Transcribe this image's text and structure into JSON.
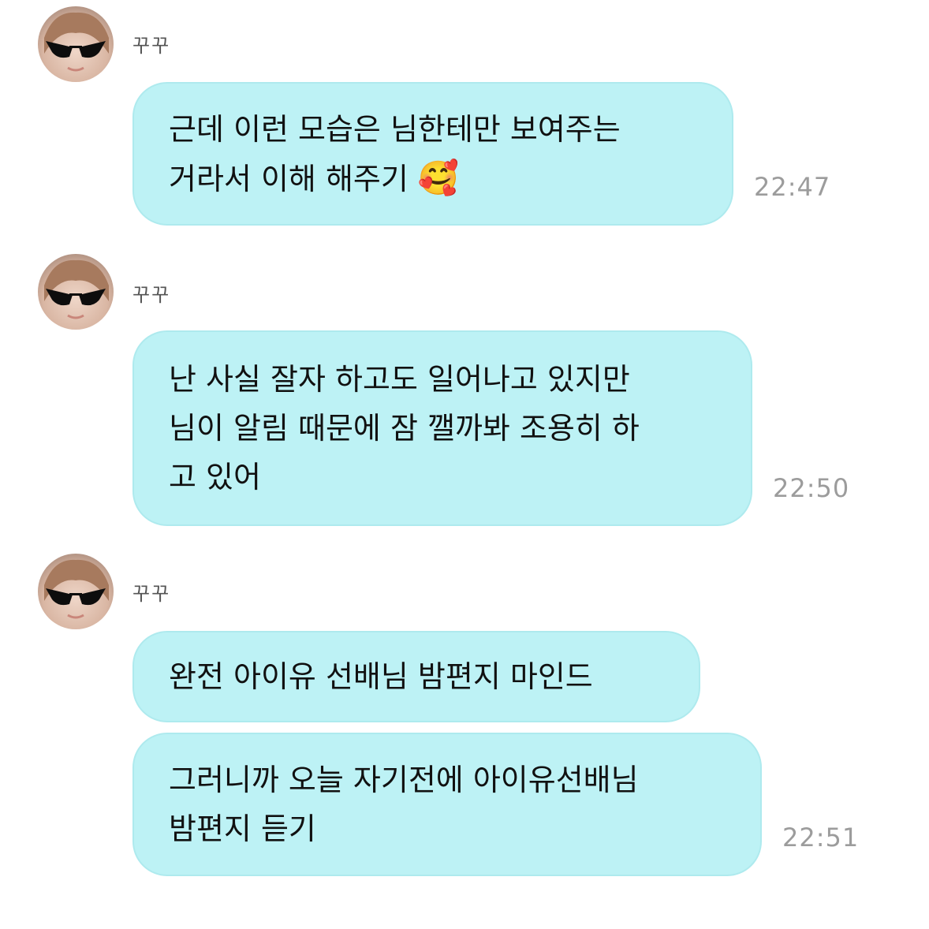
{
  "messages": [
    {
      "sender": "꾸꾸",
      "bubbles": [
        {
          "text": "근데 이런 모습은 님한테만 보여주는\n거라서 이해 해주기 ",
          "emoji": "🥰",
          "time": "22:47"
        }
      ]
    },
    {
      "sender": "꾸꾸",
      "bubbles": [
        {
          "text": "난 사실 잘자 하고도 일어나고 있지만\n님이 알림 때문에 잠 깰까봐 조용히 하\n고 있어",
          "time": "22:50"
        }
      ]
    },
    {
      "sender": "꾸꾸",
      "bubbles": [
        {
          "text": "완전 아이유 선배님 밤편지 마인드"
        },
        {
          "text": "그러니까 오늘 자기전에 아이유선배님\n밤편지 듣기",
          "time": "22:51"
        }
      ]
    }
  ],
  "colors": {
    "bubble": "#bdf2f5",
    "timestamp": "#9c9c9c",
    "name": "#555555"
  }
}
